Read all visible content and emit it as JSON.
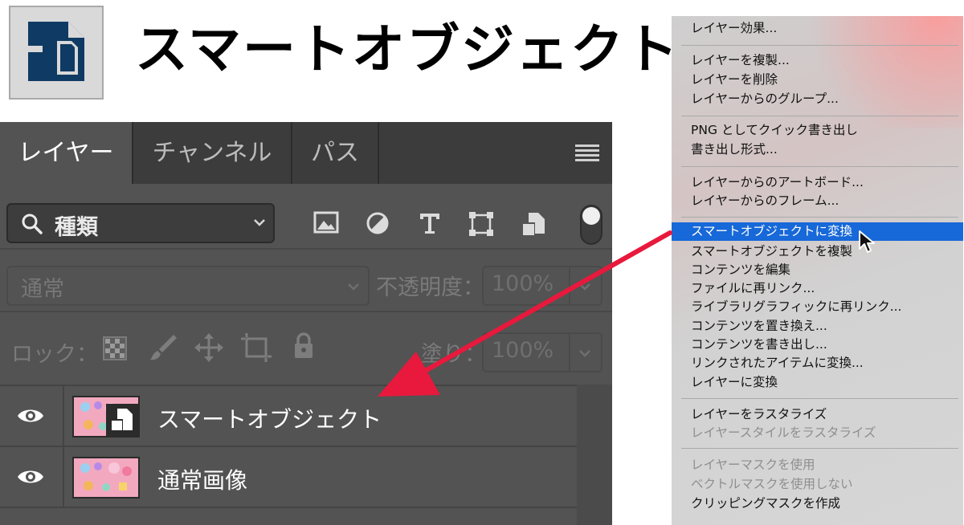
{
  "header": {
    "title": "スマートオブジェクト",
    "logo_icon": "smart-object-icon"
  },
  "panel": {
    "tabs": [
      "レイヤー",
      "チャンネル",
      "パス"
    ],
    "active_tab": "レイヤー",
    "filter": {
      "label": "種類"
    },
    "blend_mode": "通常",
    "opacity_label": "不透明度：",
    "opacity_value": "100%",
    "lock_label": "ロック：",
    "fill_label": "塗り：",
    "fill_value": "100%",
    "layers": [
      {
        "name": "スマートオブジェクト",
        "is_smart_object": true,
        "visible": true
      },
      {
        "name": "通常画像",
        "is_smart_object": false,
        "visible": true
      }
    ]
  },
  "context_menu": {
    "items": [
      {
        "label": "レイヤー効果...",
        "enabled": true
      },
      {
        "label": "レイヤーを複製...",
        "enabled": true
      },
      {
        "label": "レイヤーを削除",
        "enabled": true
      },
      {
        "label": "レイヤーからのグループ...",
        "enabled": true
      },
      {
        "label": "PNG としてクイック書き出し",
        "enabled": true
      },
      {
        "label": "書き出し形式...",
        "enabled": true
      },
      {
        "label": "レイヤーからのアートボード...",
        "enabled": true
      },
      {
        "label": "レイヤーからのフレーム...",
        "enabled": true
      },
      {
        "label": "スマートオブジェクトに変換",
        "enabled": true,
        "highlighted": true
      },
      {
        "label": "スマートオブジェクトを複製",
        "enabled": true
      },
      {
        "label": "コンテンツを編集",
        "enabled": true
      },
      {
        "label": "ファイルに再リンク...",
        "enabled": true
      },
      {
        "label": "ライブラリグラフィックに再リンク...",
        "enabled": true
      },
      {
        "label": "コンテンツを置き換え...",
        "enabled": true
      },
      {
        "label": "コンテンツを書き出し...",
        "enabled": true
      },
      {
        "label": "リンクされたアイテムに変換...",
        "enabled": true
      },
      {
        "label": "レイヤーに変換",
        "enabled": true
      },
      {
        "label": "レイヤーをラスタライズ",
        "enabled": true
      },
      {
        "label": "レイヤースタイルをラスタライズ",
        "enabled": false
      },
      {
        "label": "レイヤーマスクを使用",
        "enabled": false
      },
      {
        "label": "ベクトルマスクを使用しない",
        "enabled": false
      },
      {
        "label": "クリッピングマスクを作成",
        "enabled": true
      }
    ]
  },
  "colors": {
    "accent_arrow": "#e8193c",
    "menu_highlight": "#1768d8",
    "logo_blue": "#0f3a63",
    "panel_bg": "#535353"
  }
}
